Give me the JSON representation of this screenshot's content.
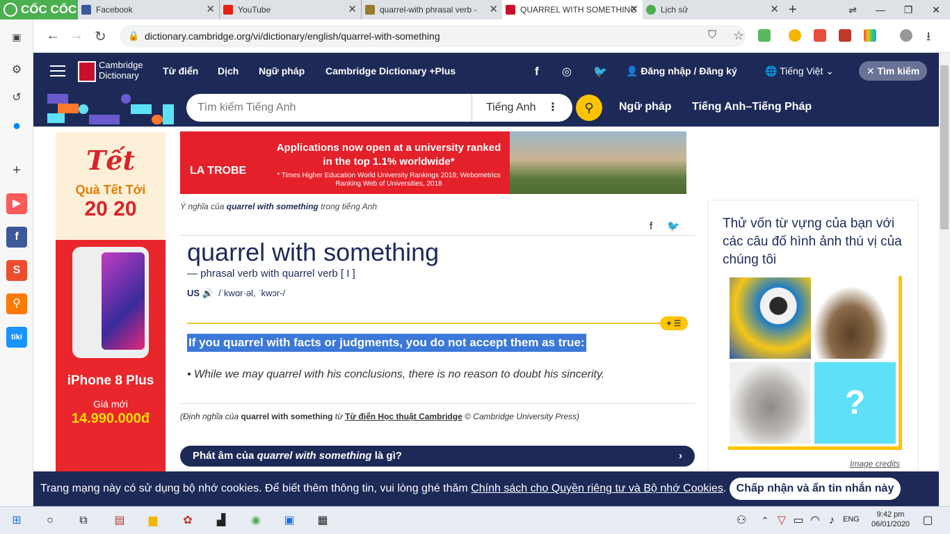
{
  "browser": {
    "brand": "CỐC CỐC",
    "tabs": [
      {
        "title": "Facebook"
      },
      {
        "title": "YouTube"
      },
      {
        "title": "quarrel-with phrasal verb -"
      },
      {
        "title": "QUARREL WITH SOMETHING"
      },
      {
        "title": "Lịch sử"
      }
    ],
    "url": "dictionary.cambridge.org/vi/dictionary/english/quarrel-with-something"
  },
  "site": {
    "logo_line1": "Cambridge",
    "logo_line2": "Dictionary",
    "nav": [
      "Từ điển",
      "Dịch",
      "Ngữ pháp",
      "Cambridge Dictionary +Plus"
    ],
    "signin": "Đăng nhập / Đăng ký",
    "language": "Tiếng Việt",
    "search_button": "Tìm kiếm",
    "search_placeholder": "Tìm kiếm Tiếng Anh",
    "search_dictionary": "Tiếng Anh",
    "links": [
      "Ngữ pháp",
      "Tiếng Anh–Tiếng Pháp"
    ]
  },
  "left_ad": {
    "tet": "Tết",
    "promo": "Quà Tết Tới",
    "amount": "20 20",
    "product": "iPhone 8 Plus",
    "price_label": "Giá mới",
    "price": "14.990.000đ"
  },
  "top_ad": {
    "brand": "LA TROBE",
    "headline": "Applications now open at a university ranked in the top 1.1% worldwide*",
    "footnote": "* Times Higher Education World University Rankings 2019; Webometrics Ranking Web of Universities, 2018"
  },
  "entry": {
    "crumb_pre": "Ý nghĩa của",
    "crumb_word": "quarrel with something",
    "crumb_post": "trong tiếng Anh",
    "headword": "quarrel with something",
    "pos_line": "— phrasal verb with quarrel verb [ I ]",
    "region": "US",
    "ipa": "/ˈkwɑr·əl, ˈkwɔr-/",
    "definition": "If you quarrel with facts or judgments, you do not accept them as true:",
    "example": "While we may quarrel with his conclusions, there is no reason to doubt his sincerity.",
    "cite_pre": "(Định nghĩa của",
    "cite_word": "quarrel with something",
    "cite_mid": "từ",
    "cite_source": "Từ điển Học thuật Cambridge",
    "cite_post": "© Cambridge University Press)",
    "pron_bar_pre": "Phát âm của",
    "pron_bar_word": "quarrel with something",
    "pron_bar_post": "là gì?"
  },
  "quiz": {
    "title": "Thử vốn từ vựng của bạn với các câu đố hình ảnh thú vị của chúng tôi",
    "credits": "Image credits"
  },
  "cookie": {
    "text_pre": "Trang mạng này có sử dụng bộ nhớ cookies. Để biết thêm thông tin, vui lòng ghé thăm",
    "link": "Chính sách cho Quyền riêng tư và Bộ nhớ Cookies",
    "text_post": ".",
    "accept": "Chấp nhận và ẩn tin nhắn này"
  },
  "taskbar": {
    "lang": "ENG",
    "time": "9:42 pm",
    "date": "06/01/2020"
  },
  "colors": {
    "cd_navy": "#1d2a57",
    "cd_yellow": "#fec400",
    "highlight": "#3b78d8",
    "coccoc_green": "#4caf50"
  }
}
